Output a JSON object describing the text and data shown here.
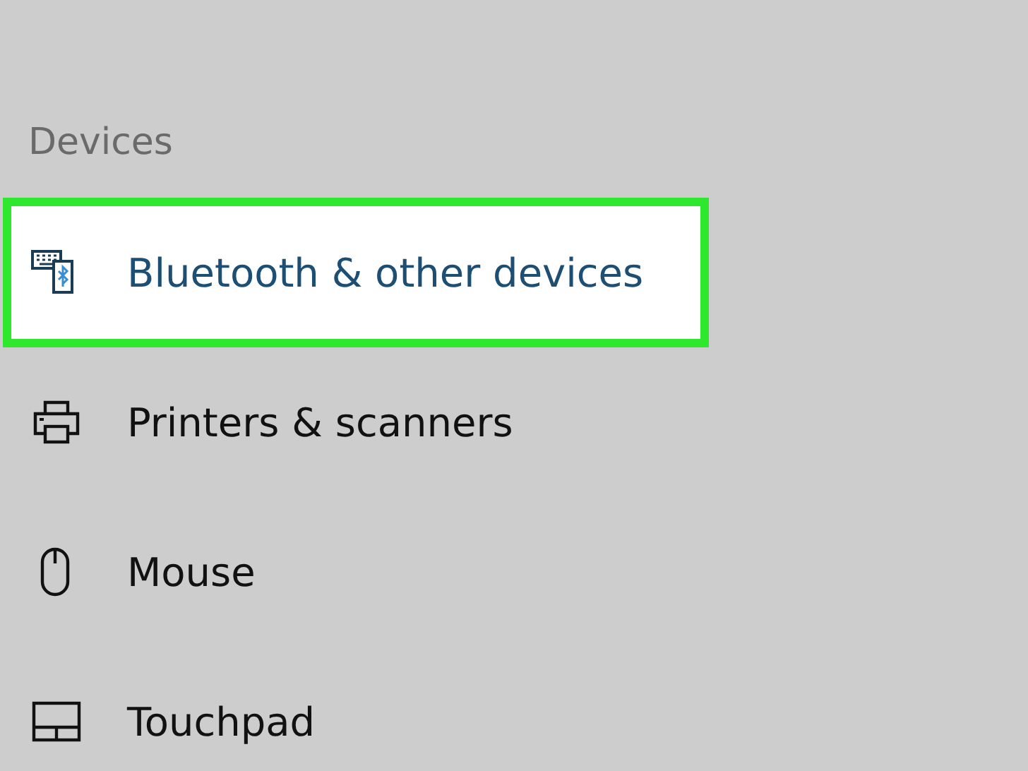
{
  "section": {
    "title": "Devices"
  },
  "items": [
    {
      "kind": "bluetooth",
      "label": "Bluetooth & other devices",
      "selected": true
    },
    {
      "kind": "printer",
      "label": "Printers & scanners",
      "selected": false
    },
    {
      "kind": "mouse",
      "label": "Mouse",
      "selected": false
    },
    {
      "kind": "touchpad",
      "label": "Touchpad",
      "selected": false
    }
  ]
}
